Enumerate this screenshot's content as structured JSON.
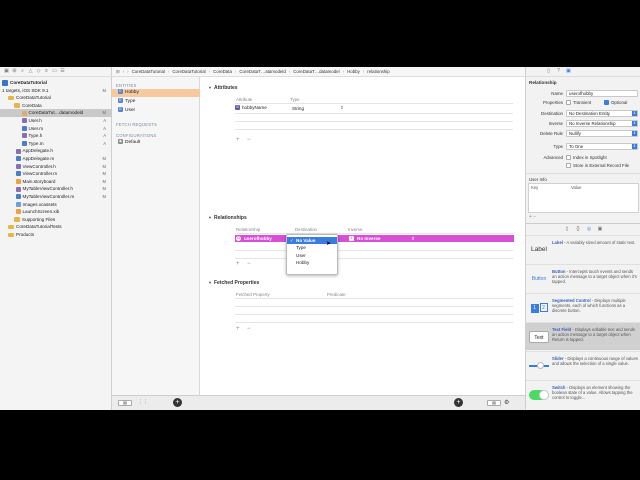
{
  "navigator": {
    "items": [
      {
        "label": "CoreDataTutorial",
        "badge": "",
        "icon": "project-icon",
        "indent": 2,
        "bold": true
      },
      {
        "label": "1 targets, iOS SDK 9.1",
        "badge": "M",
        "icon": "",
        "indent": 2,
        "bold": false
      },
      {
        "label": "CoreDataTutorial",
        "badge": "",
        "icon": "folder-icon",
        "indent": 8,
        "bold": false
      },
      {
        "label": "CoreData",
        "badge": "",
        "icon": "folder-icon",
        "indent": 14,
        "bold": false
      },
      {
        "label": "CoreDataTut…datamodeld",
        "badge": "M",
        "icon": "datamodel-icon",
        "indent": 22,
        "bold": false,
        "selected": true
      },
      {
        "label": "User.h",
        "badge": "A",
        "icon": "header-file-icon",
        "indent": 22,
        "bold": false
      },
      {
        "label": "User.m",
        "badge": "A",
        "icon": "implementation-file-icon",
        "indent": 22,
        "bold": false
      },
      {
        "label": "Type.h",
        "badge": "A",
        "icon": "header-file-icon",
        "indent": 22,
        "bold": false
      },
      {
        "label": "Type.m",
        "badge": "A",
        "icon": "implementation-file-icon",
        "indent": 22,
        "bold": false
      },
      {
        "label": "AppDelegate.h",
        "badge": "",
        "icon": "header-file-icon",
        "indent": 16,
        "bold": false
      },
      {
        "label": "AppDelegate.m",
        "badge": "M",
        "icon": "implementation-file-icon",
        "indent": 16,
        "bold": false
      },
      {
        "label": "ViewController.h",
        "badge": "M",
        "icon": "header-file-icon",
        "indent": 16,
        "bold": false
      },
      {
        "label": "ViewController.m",
        "badge": "M",
        "icon": "implementation-file-icon",
        "indent": 16,
        "bold": false
      },
      {
        "label": "Main.storyboard",
        "badge": "M",
        "icon": "storyboard-icon",
        "indent": 16,
        "bold": false
      },
      {
        "label": "MyTableViewController.h",
        "badge": "M",
        "icon": "header-file-icon",
        "indent": 16,
        "bold": false
      },
      {
        "label": "MyTableViewController.m",
        "badge": "M",
        "icon": "implementation-file-icon",
        "indent": 16,
        "bold": false
      },
      {
        "label": "Images.xcassets",
        "badge": "",
        "icon": "assets-icon",
        "indent": 16,
        "bold": false
      },
      {
        "label": "LaunchScreen.xib",
        "badge": "",
        "icon": "xib-icon",
        "indent": 16,
        "bold": false
      },
      {
        "label": "Supporting Files",
        "badge": "",
        "icon": "folder-icon",
        "indent": 14,
        "bold": false
      },
      {
        "label": "CoreDataTutorialTests",
        "badge": "",
        "icon": "folder-icon",
        "indent": 8,
        "bold": false
      },
      {
        "label": "Products",
        "badge": "",
        "icon": "folder-icon",
        "indent": 8,
        "bold": false
      }
    ]
  },
  "jumpbar": {
    "crumbs": [
      "CoreDataTutorial",
      "CoreDataTutorial",
      "CoreData",
      "CoreDataT…atamodeld",
      "CoreDataT…datamodel",
      "Hobby",
      "relationship"
    ]
  },
  "entities": {
    "entities_header": "ENTITIES",
    "entity_list": [
      "Hobby",
      "Type",
      "User"
    ],
    "fetch_header": "FETCH REQUESTS",
    "config_header": "CONFIGURATIONS",
    "config_list": [
      "Default"
    ]
  },
  "editor": {
    "attributes": {
      "title": "Attributes",
      "col_attribute": "Attribute",
      "col_type": "Type",
      "row_name": "hobbyName",
      "row_type": "String",
      "row_badge": "S"
    },
    "relationships": {
      "title": "Relationships",
      "col_relationship": "Relationship",
      "col_destination": "Destination",
      "col_inverse": "Inverse",
      "row_name": "userofhobby",
      "row_badge": "O",
      "row_inverse": "No Inverse"
    },
    "destination_popup": {
      "options": [
        "No Value",
        "Type",
        "User",
        "Hobby"
      ],
      "selected": "No Value"
    },
    "fetched_properties": {
      "title": "Fetched Properties",
      "col_fetched_property": "Fetched Property",
      "col_predicate": "Predicate"
    }
  },
  "inspector": {
    "header": "Relationship",
    "name_label": "Name",
    "name_value": "userofhobby",
    "properties_label": "Properties",
    "transient_label": "Transient",
    "optional_label": "Optional",
    "destination_label": "Destination",
    "destination_value": "No Destination Entity",
    "inverse_label": "Inverse",
    "inverse_value": "No Inverse Relationship",
    "delete_rule_label": "Delete Rule",
    "delete_rule_value": "Nullify",
    "type_label": "Type",
    "type_value": "To One",
    "advanced_label": "Advanced",
    "index_spotlight_label": "Index in Spotlight",
    "external_record_label": "Store in External Record File",
    "user_info_header": "User Info",
    "key_col": "Key",
    "value_col": "Value"
  },
  "library": [
    {
      "icon_text": "Label",
      "title": "Label",
      "desc": " - A variably sized amount of static text."
    },
    {
      "icon_text": "Button",
      "title": "Button",
      "desc": " - Intercepts touch events and sends an action message to a target object when it's tapped."
    },
    {
      "icon_text": "1 2",
      "title": "Segmented Control",
      "desc": " - Displays multiple segments, each of which functions as a discrete button."
    },
    {
      "icon_text": "Text",
      "title": "Text Field",
      "desc": " - Displays editable text and sends an action message to a target object when Return is tapped."
    },
    {
      "icon_text": "",
      "title": "Slider",
      "desc": " - Displays a continuous range of values and allows the selection of a single value."
    },
    {
      "icon_text": "",
      "title": "Switch",
      "desc": " - Displays an element showing the boolean state of a value. Allows tapping the control to toggle..."
    }
  ],
  "colors": {
    "selected_relationship": "#d74fd4",
    "selected_entity": "#f6c9a0",
    "accent": "#3a7de0"
  }
}
